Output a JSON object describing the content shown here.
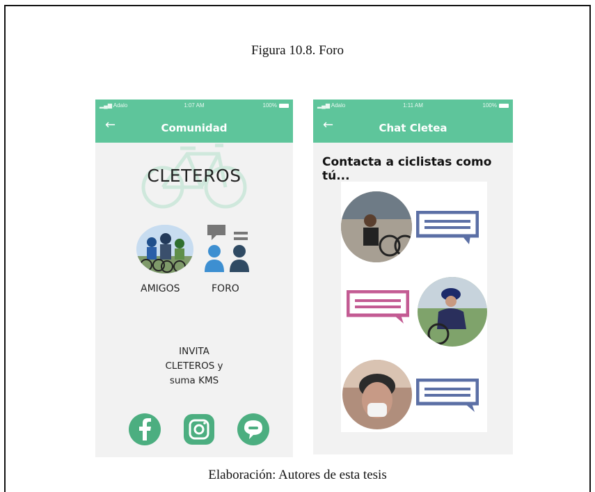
{
  "figure": {
    "title": "Figura 10.8. Foro",
    "caption": "Elaboración: Autores de esta tesis"
  },
  "phone1": {
    "status": {
      "carrier": "Adalo",
      "time": "1:07 AM",
      "battery": "100%"
    },
    "header_title": "Comunidad",
    "brand": "CLETEROS",
    "amigos_label": "AMIGOS",
    "foro_label": "FORO",
    "invite_line1": "INVITA",
    "invite_line2": "CLETEROS y",
    "invite_line3": "suma KMS",
    "social": [
      "facebook-icon",
      "instagram-icon",
      "chat-bubble-icon"
    ]
  },
  "phone2": {
    "status": {
      "carrier": "Adalo",
      "time": "1:11 AM",
      "battery": "100%"
    },
    "header_title": "Chat Cletea",
    "heading": "Contacta a ciclistas como tú..."
  },
  "colors": {
    "header_green": "#5ec59b",
    "icon_green": "#4cae80",
    "bubble_blue": "#5b6fa5",
    "bubble_pink": "#c35b93",
    "people_blue": "#3d8fd1",
    "people_dark": "#2f4a63"
  }
}
